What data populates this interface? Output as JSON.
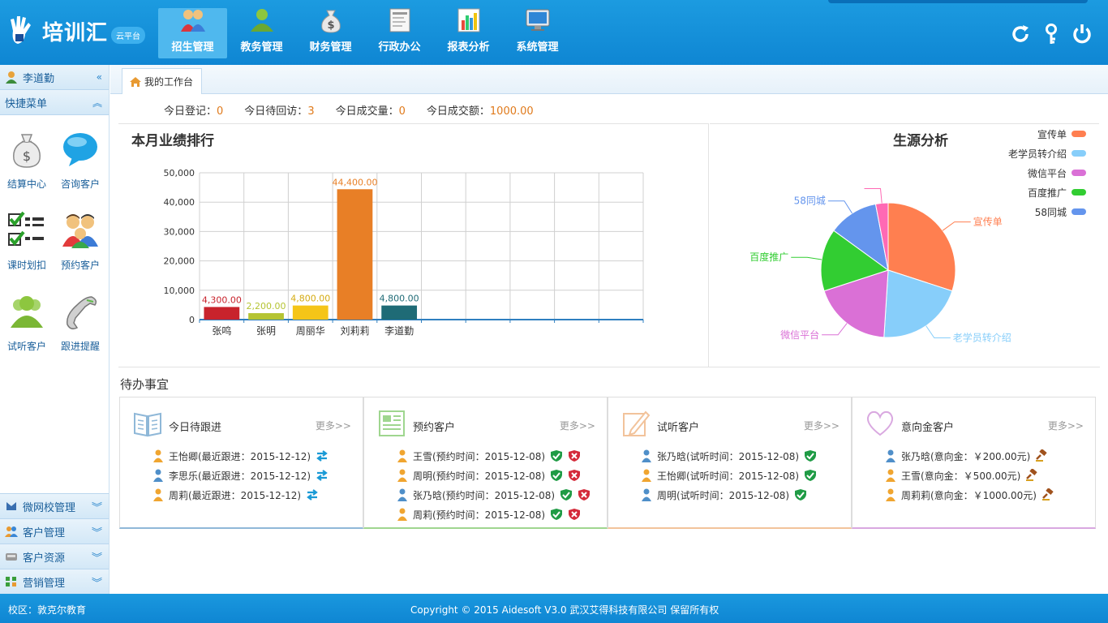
{
  "header": {
    "logo_text": "培训汇",
    "logo_badge": "云平台",
    "nav": [
      {
        "label": "招生管理",
        "active": true
      },
      {
        "label": "教务管理",
        "active": false
      },
      {
        "label": "财务管理",
        "active": false
      },
      {
        "label": "行政办公",
        "active": false
      },
      {
        "label": "报表分析",
        "active": false
      },
      {
        "label": "系统管理",
        "active": false
      }
    ]
  },
  "sidebar": {
    "user": "李道勤",
    "quick_title": "快捷菜单",
    "quick_items": [
      {
        "label": "结算中心",
        "icon": "money-bag-icon"
      },
      {
        "label": "咨询客户",
        "icon": "chat-bubble-icon"
      },
      {
        "label": "课时划扣",
        "icon": "checklist-icon"
      },
      {
        "label": "预约客户",
        "icon": "people-icon"
      },
      {
        "label": "试听客户",
        "icon": "user-group-icon"
      },
      {
        "label": "跟进提醒",
        "icon": "phone-icon"
      }
    ],
    "bottom_items": [
      {
        "label": "微网校管理",
        "icon": "school-icon"
      },
      {
        "label": "客户管理",
        "icon": "customers-icon"
      },
      {
        "label": "客户资源",
        "icon": "resources-icon"
      },
      {
        "label": "营销管理",
        "icon": "marketing-icon"
      }
    ]
  },
  "tabs": {
    "home": "我的工作台"
  },
  "stats": [
    {
      "label": "今日登记：",
      "value": "0"
    },
    {
      "label": "今日待回访：",
      "value": "3"
    },
    {
      "label": "今日成交量：",
      "value": "0"
    },
    {
      "label": "今日成交额：",
      "value": "1000.00"
    }
  ],
  "perf_title": "本月业绩排行",
  "source_title": "生源分析",
  "chart_data": [
    {
      "type": "bar",
      "title": "本月业绩排行",
      "categories": [
        "张鸣",
        "张明",
        "周丽华",
        "刘莉莉",
        "李道勤"
      ],
      "values": [
        4300,
        2200,
        4800,
        44400,
        4800
      ],
      "value_labels": [
        "4,300.00",
        "2,200.00",
        "4,800.00",
        "44,400.00",
        "4,800.00"
      ],
      "colors": [
        "#c8232c",
        "#b5c433",
        "#f5c518",
        "#e87f26",
        "#1f6b76"
      ],
      "empty_slots": 5,
      "ylim": [
        0,
        50000
      ],
      "yticks": [
        "0",
        "10,000",
        "20,000",
        "30,000",
        "40,000",
        "50,000"
      ],
      "grid": true
    },
    {
      "type": "pie",
      "title": "生源分析",
      "labels": [
        "宣传单",
        "老学员转介绍",
        "微信平台",
        "百度推广",
        "58同城",
        ""
      ],
      "values": [
        30,
        21,
        19,
        15,
        12,
        3
      ],
      "colors": [
        "#ff7f50",
        "#87cefa",
        "#da70d6",
        "#32cd32",
        "#6495ed",
        "#ff69b4"
      ],
      "legend": [
        "宣传单",
        "老学员转介绍",
        "微信平台",
        "百度推广",
        "58同城"
      ],
      "legend_position": "top-right"
    }
  ],
  "todo_title": "待办事宜",
  "cards": [
    {
      "title": "今日待跟进",
      "more": "更多>>",
      "icon": "book-icon",
      "accent": "#8fb8d8",
      "rows": [
        {
          "text": "王怡卿(最近跟进：2015-12-12)",
          "gender": "f",
          "actions": [
            "transfer"
          ]
        },
        {
          "text": "李思乐(最近跟进：2015-12-12)",
          "gender": "m",
          "actions": [
            "transfer"
          ]
        },
        {
          "text": "周莉(最近跟进：2015-12-12)",
          "gender": "f",
          "actions": [
            "transfer"
          ]
        }
      ]
    },
    {
      "title": "预约客户",
      "more": "更多>>",
      "icon": "form-icon",
      "accent": "#9fd68f",
      "rows": [
        {
          "text": "王雪(预约时间：2015-12-08)",
          "gender": "f",
          "actions": [
            "ok",
            "no"
          ]
        },
        {
          "text": "周明(预约时间：2015-12-08)",
          "gender": "f",
          "actions": [
            "ok",
            "no"
          ]
        },
        {
          "text": "张乃晗(预约时间：2015-12-08)",
          "gender": "m",
          "actions": [
            "ok",
            "no"
          ]
        },
        {
          "text": "周莉(预约时间：2015-12-08)",
          "gender": "f",
          "actions": [
            "ok",
            "no"
          ]
        }
      ]
    },
    {
      "title": "试听客户",
      "more": "更多>>",
      "icon": "pencil-icon",
      "accent": "#f2c39b",
      "rows": [
        {
          "text": "张乃晗(试听时间：2015-12-08)",
          "gender": "m",
          "actions": [
            "ok"
          ]
        },
        {
          "text": "王怡卿(试听时间：2015-12-08)",
          "gender": "f",
          "actions": [
            "ok"
          ]
        },
        {
          "text": "周明(试听时间：2015-12-08)",
          "gender": "m",
          "actions": [
            "ok"
          ]
        }
      ]
    },
    {
      "title": "意向金客户",
      "more": "更多>>",
      "icon": "heart-icon",
      "accent": "#d9a8e0",
      "rows": [
        {
          "text": "张乃晗(意向金：￥200.00元)",
          "gender": "m",
          "actions": [
            "gavel"
          ]
        },
        {
          "text": "王雪(意向金：￥500.00元)",
          "gender": "f",
          "actions": [
            "gavel"
          ]
        },
        {
          "text": "周莉莉(意向金：￥1000.00元)",
          "gender": "f",
          "actions": [
            "gavel"
          ]
        }
      ]
    }
  ],
  "footer": {
    "campus": "校区：敦克尔教育",
    "copyright": "Copyright © 2015 Aidesoft V3.0 武汉艾得科技有限公司 保留所有权"
  }
}
